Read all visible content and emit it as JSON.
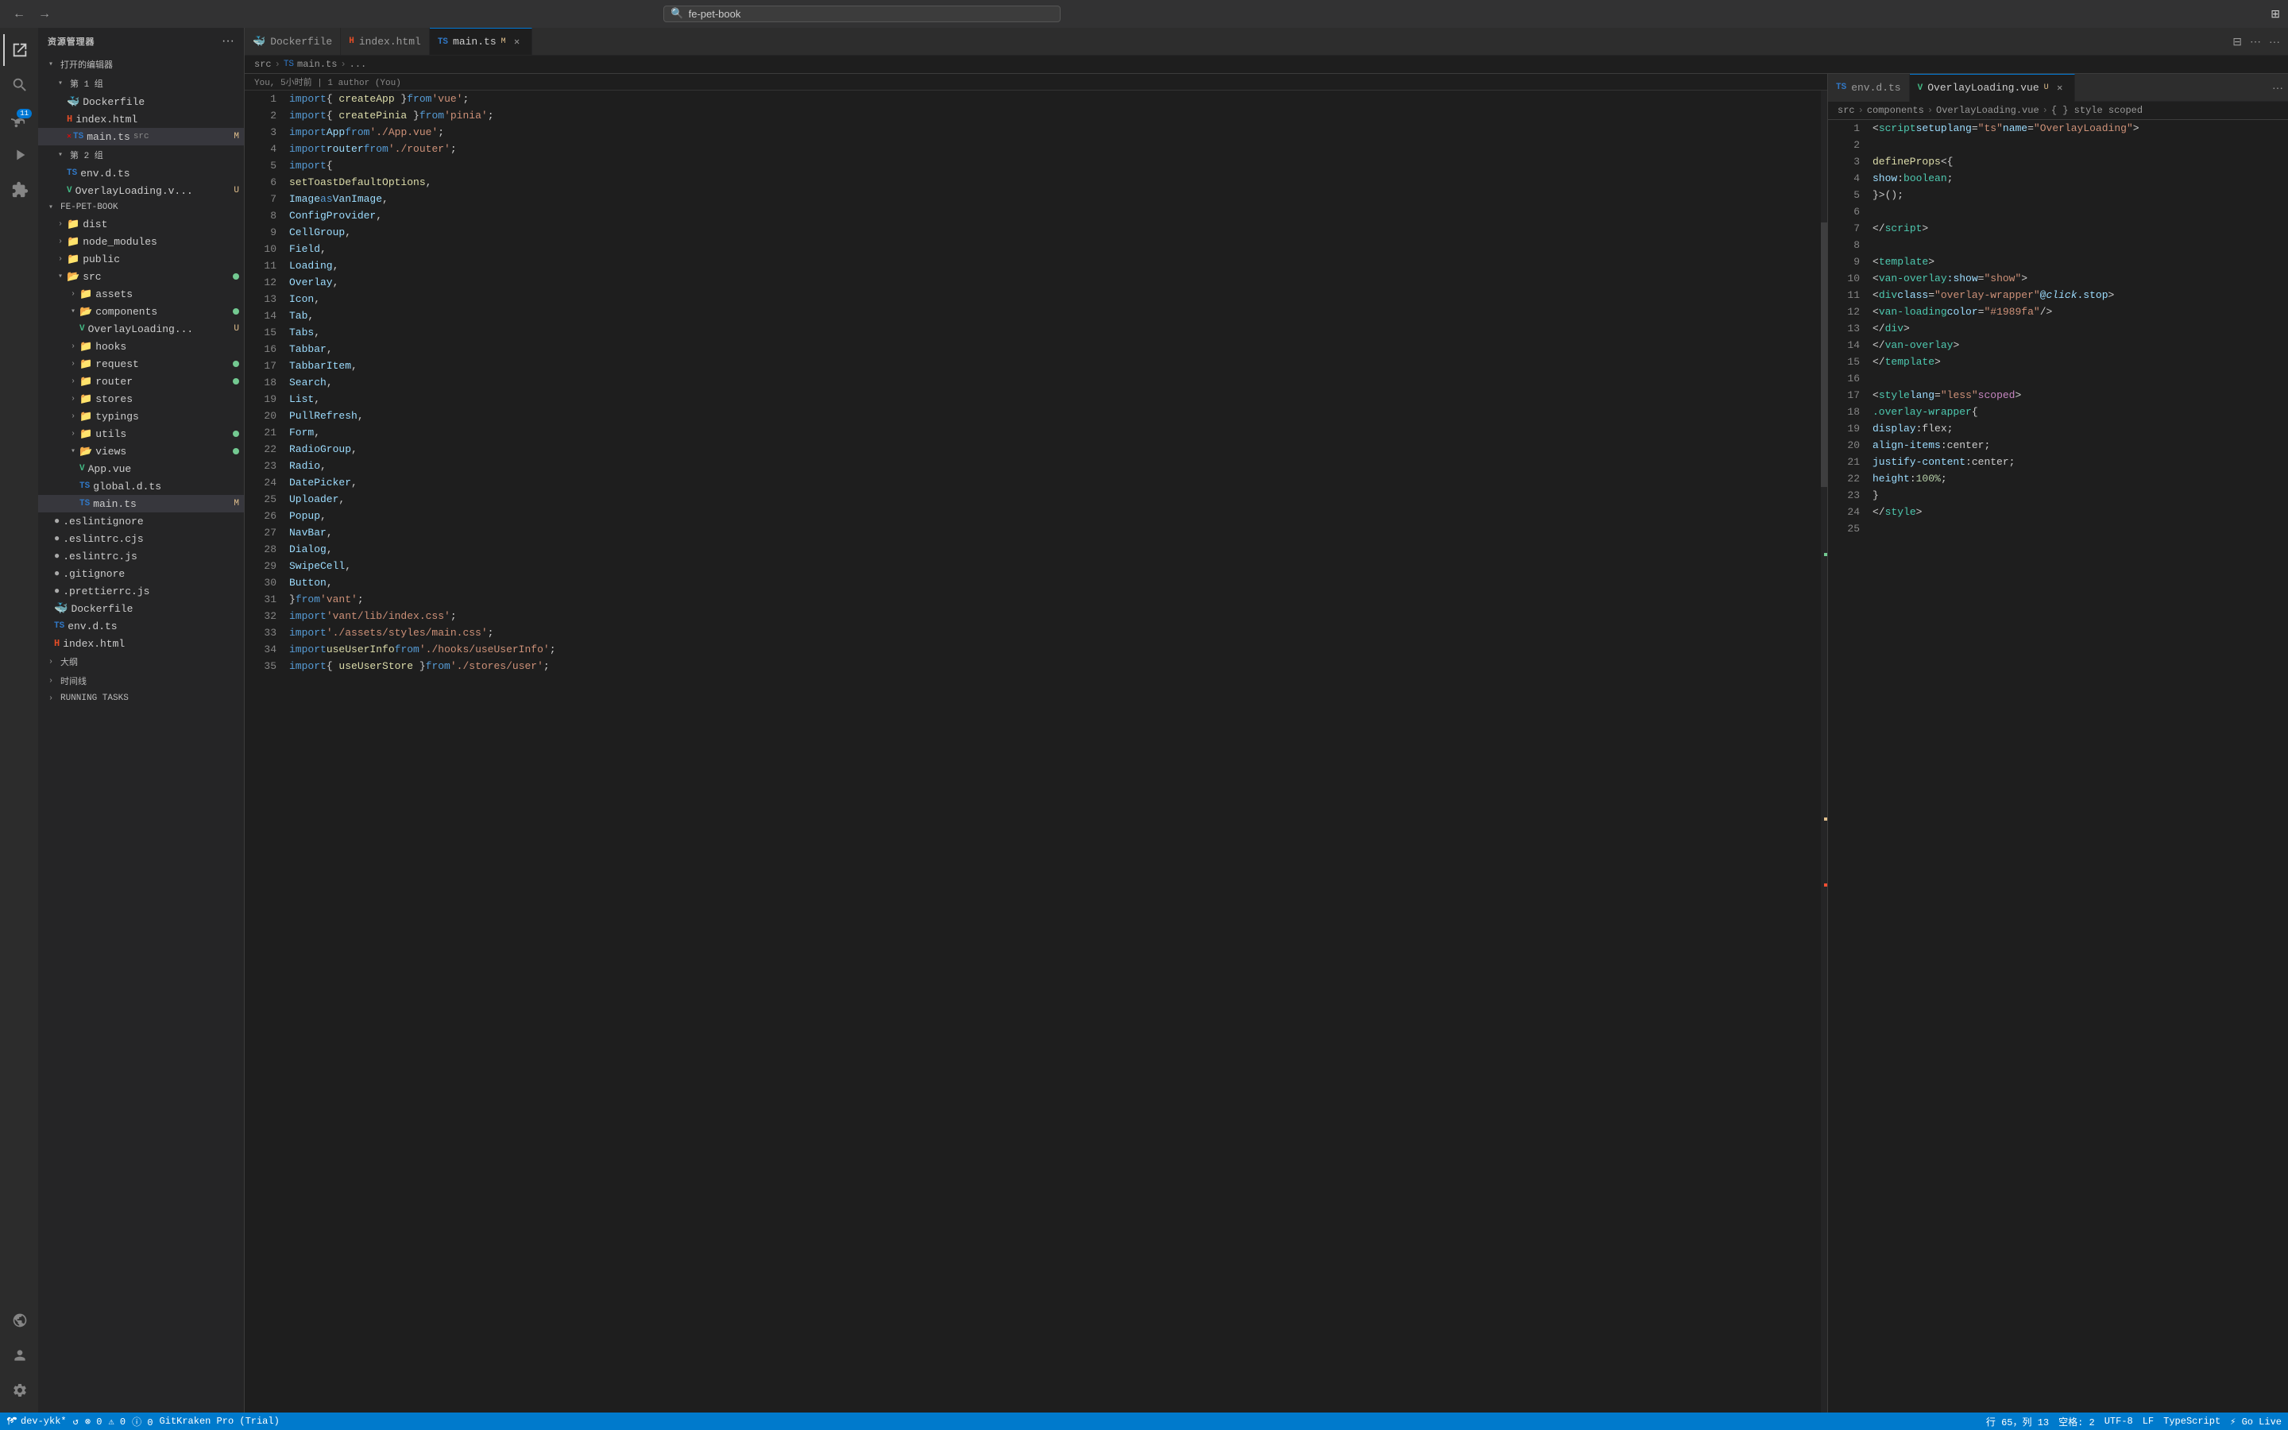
{
  "titlebar": {
    "search_placeholder": "fe-pet-book",
    "nav_back": "←",
    "nav_forward": "→"
  },
  "activity_bar": {
    "items": [
      {
        "name": "explorer-icon",
        "icon": "⎇",
        "label": "Explorer"
      },
      {
        "name": "search-icon",
        "icon": "🔍",
        "label": "Search"
      },
      {
        "name": "source-control-icon",
        "icon": "⑂",
        "label": "Source Control",
        "badge": "11"
      },
      {
        "name": "run-icon",
        "icon": "▷",
        "label": "Run"
      },
      {
        "name": "extensions-icon",
        "icon": "⊞",
        "label": "Extensions"
      }
    ],
    "bottom": [
      {
        "name": "remote-icon",
        "icon": "⧉",
        "label": "Remote"
      },
      {
        "name": "account-icon",
        "icon": "👤",
        "label": "Account"
      },
      {
        "name": "settings-icon",
        "icon": "⚙",
        "label": "Settings"
      }
    ]
  },
  "sidebar": {
    "title": "资源管理器",
    "sections": {
      "open_editors": {
        "label": "打开的编辑器",
        "group1_label": "第 1 组",
        "group1_files": [
          {
            "name": "Dockerfile",
            "icon": "docker",
            "modified": false
          },
          {
            "name": "index.html",
            "icon": "html",
            "modified": false
          },
          {
            "name": "main.ts",
            "icon": "ts",
            "path": "src",
            "modified": true,
            "active": true
          }
        ],
        "group2_label": "第 2 组",
        "group2_files": [
          {
            "name": "env.d.ts",
            "icon": "ts",
            "modified": false
          },
          {
            "name": "OverlayLoading.v...",
            "icon": "vue",
            "modified": true
          }
        ]
      },
      "project": {
        "label": "FE-PET-BOOK",
        "items": [
          {
            "name": "dist",
            "icon": "folder",
            "type": "folder",
            "indent": 1
          },
          {
            "name": "node_modules",
            "icon": "folder",
            "type": "folder",
            "indent": 1
          },
          {
            "name": "public",
            "icon": "folder",
            "type": "folder",
            "indent": 1
          },
          {
            "name": "src",
            "icon": "folder",
            "type": "folder",
            "indent": 1,
            "modified": true,
            "open": true
          },
          {
            "name": "assets",
            "icon": "folder",
            "type": "folder",
            "indent": 2
          },
          {
            "name": "components",
            "icon": "folder",
            "type": "folder",
            "indent": 2,
            "modified": true,
            "open": true
          },
          {
            "name": "OverlayLoading...",
            "icon": "vue",
            "type": "file",
            "indent": 3,
            "modified": true
          },
          {
            "name": "hooks",
            "icon": "folder",
            "type": "folder",
            "indent": 2
          },
          {
            "name": "request",
            "icon": "folder",
            "type": "folder",
            "indent": 2,
            "modified": true
          },
          {
            "name": "router",
            "icon": "folder",
            "type": "folder",
            "indent": 2,
            "modified": true
          },
          {
            "name": "stores",
            "icon": "folder",
            "type": "folder",
            "indent": 2
          },
          {
            "name": "typings",
            "icon": "folder",
            "type": "folder",
            "indent": 2
          },
          {
            "name": "utils",
            "icon": "folder",
            "type": "folder",
            "indent": 2,
            "modified": true
          },
          {
            "name": "views",
            "icon": "folder",
            "type": "folder",
            "indent": 2,
            "modified": true,
            "open": true
          },
          {
            "name": "App.vue",
            "icon": "vue",
            "type": "file",
            "indent": 3
          },
          {
            "name": "global.d.ts",
            "icon": "ts",
            "type": "file",
            "indent": 3
          },
          {
            "name": "main.ts",
            "icon": "ts",
            "type": "file",
            "indent": 3,
            "modified": true,
            "active": true
          },
          {
            "name": ".eslintignore",
            "icon": "git",
            "type": "file",
            "indent": 1
          },
          {
            "name": ".eslintrc.cjs",
            "icon": "js",
            "type": "file",
            "indent": 1
          },
          {
            "name": ".eslintrc.js",
            "icon": "js",
            "type": "file",
            "indent": 1
          },
          {
            "name": ".gitignore",
            "icon": "git",
            "type": "file",
            "indent": 1
          },
          {
            "name": ".prettierrc.js",
            "icon": "js",
            "type": "file",
            "indent": 1
          },
          {
            "name": "Dockerfile",
            "icon": "docker",
            "type": "file",
            "indent": 1
          },
          {
            "name": "env.d.ts",
            "icon": "ts",
            "type": "file",
            "indent": 1
          },
          {
            "name": "index.html",
            "icon": "html",
            "type": "file",
            "indent": 1
          }
        ]
      },
      "account": {
        "label": "大纲"
      },
      "timeline": {
        "label": "时间线"
      },
      "running_tasks": {
        "label": "RUNNING TASKS"
      }
    }
  },
  "editor_left": {
    "tabs": [
      {
        "name": "Dockerfile",
        "icon": "docker",
        "active": false,
        "closable": false
      },
      {
        "name": "index.html",
        "icon": "html",
        "active": false,
        "closable": false
      },
      {
        "name": "main.ts",
        "icon": "ts",
        "active": true,
        "modified": true,
        "closable": true
      }
    ],
    "breadcrumb": [
      "src",
      ">",
      "ts",
      "main.ts",
      ">",
      "..."
    ],
    "git_blame": "You, 5小时前 | 1 author (You)",
    "lines": [
      {
        "n": 1,
        "code": "<span class='kw'>import</span> <span class='punct'>{ </span><span class='fn'>createApp</span><span class='punct'> }</span> <span class='kw'>from</span> <span class='str'>'vue'</span><span class='punct'>;</span>"
      },
      {
        "n": 2,
        "code": "<span class='kw'>import</span> <span class='punct'>{ </span><span class='fn'>createPinia</span><span class='punct'> }</span> <span class='kw'>from</span> <span class='str'>'pinia'</span><span class='punct'>;</span>"
      },
      {
        "n": 3,
        "code": "<span class='kw'>import</span> <span class='var'>App</span> <span class='kw'>from</span> <span class='str'>'./App.vue'</span><span class='punct'>;</span>"
      },
      {
        "n": 4,
        "code": "<span class='kw'>import</span> <span class='var'>router</span> <span class='kw'>from</span> <span class='str'>'./router'</span><span class='punct'>;</span>"
      },
      {
        "n": 5,
        "code": "<span class='kw'>import</span> <span class='punct'>{</span>"
      },
      {
        "n": 6,
        "code": "  <span class='fn'>setToastDefaultOptions</span><span class='punct'>,</span>"
      },
      {
        "n": 7,
        "code": "  <span class='var'>Image</span> <span class='kw'>as</span> <span class='var'>VanImage</span><span class='punct'>,</span>"
      },
      {
        "n": 8,
        "code": "  <span class='var'>ConfigProvider</span><span class='punct'>,</span>"
      },
      {
        "n": 9,
        "code": "  <span class='var'>CellGroup</span><span class='punct'>,</span>"
      },
      {
        "n": 10,
        "code": "  <span class='var'>Field</span><span class='punct'>,</span>"
      },
      {
        "n": 11,
        "code": "  <span class='var'>Loading</span><span class='punct'>,</span>"
      },
      {
        "n": 12,
        "code": "  <span class='var'>Overlay</span><span class='punct'>,</span>"
      },
      {
        "n": 13,
        "code": "  <span class='var'>Icon</span><span class='punct'>,</span>"
      },
      {
        "n": 14,
        "code": "  <span class='var'>Tab</span><span class='punct'>,</span>"
      },
      {
        "n": 15,
        "code": "  <span class='var'>Tabs</span><span class='punct'>,</span>"
      },
      {
        "n": 16,
        "code": "  <span class='var'>Tabbar</span><span class='punct'>,</span>"
      },
      {
        "n": 17,
        "code": "  <span class='var'>TabbarItem</span><span class='punct'>,</span>"
      },
      {
        "n": 18,
        "code": "  <span class='var'>Search</span><span class='punct'>,</span>"
      },
      {
        "n": 19,
        "code": "  <span class='var'>List</span><span class='punct'>,</span>"
      },
      {
        "n": 20,
        "code": "  <span class='var'>PullRefresh</span><span class='punct'>,</span>"
      },
      {
        "n": 21,
        "code": "  <span class='var'>Form</span><span class='punct'>,</span>"
      },
      {
        "n": 22,
        "code": "  <span class='var'>RadioGroup</span><span class='punct'>,</span>"
      },
      {
        "n": 23,
        "code": "  <span class='var'>Radio</span><span class='punct'>,</span>"
      },
      {
        "n": 24,
        "code": "  <span class='var'>DatePicker</span><span class='punct'>,</span>"
      },
      {
        "n": 25,
        "code": "  <span class='var'>Uploader</span><span class='punct'>,</span>"
      },
      {
        "n": 26,
        "code": "  <span class='var'>Popup</span><span class='punct'>,</span>"
      },
      {
        "n": 27,
        "code": "  <span class='var'>NavBar</span><span class='punct'>,</span>"
      },
      {
        "n": 28,
        "code": "  <span class='var'>Dialog</span><span class='punct'>,</span>"
      },
      {
        "n": 29,
        "code": "  <span class='var'>SwipeCell</span><span class='punct'>,</span>"
      },
      {
        "n": 30,
        "code": "  <span class='var'>Button</span><span class='punct'>,</span>"
      },
      {
        "n": 31,
        "code": "<span class='punct'>}</span> <span class='kw'>from</span> <span class='str'>'vant'</span><span class='punct'>;</span>"
      },
      {
        "n": 32,
        "code": "<span class='kw'>import</span> <span class='str'>'vant/lib/index.css'</span><span class='punct'>;</span>"
      },
      {
        "n": 33,
        "code": "<span class='kw'>import</span> <span class='str'>'./assets/styles/main.css'</span><span class='punct'>;</span>"
      },
      {
        "n": 34,
        "code": "<span class='kw'>import</span> <span class='fn'>useUserInfo</span> <span class='kw'>from</span> <span class='str'>'./hooks/useUserInfo'</span><span class='punct'>;</span>"
      },
      {
        "n": 35,
        "code": "<span class='kw'>import</span> <span class='punct'>{ </span><span class='fn'>useUserStore</span><span class='punct'> }</span> <span class='kw'>from</span> <span class='str'>'./stores/user'</span><span class='punct'>;</span>"
      }
    ]
  },
  "editor_right": {
    "tabs": [
      {
        "name": "env.d.ts",
        "icon": "ts",
        "active": false,
        "closable": false
      },
      {
        "name": "OverlayLoading.vue",
        "icon": "vue",
        "active": true,
        "modified": true,
        "closable": true
      }
    ],
    "breadcrumb": [
      "src",
      ">",
      "components",
      ">",
      "OverlayLoading.vue",
      ">",
      "{ } style scoped"
    ],
    "lines": [
      {
        "n": 1,
        "code": "  <span class='punct'>&lt;</span><span class='tag'>script</span> <span class='attr'>setup</span> <span class='attr'>lang</span><span class='punct'>=</span><span class='str'>\"ts\"</span> <span class='attr'>name</span><span class='punct'>=</span><span class='str'>\"OverlayLoading\"</span><span class='punct'>&gt;</span>"
      },
      {
        "n": 2,
        "code": ""
      },
      {
        "n": 3,
        "code": "  <span class='fn'>defineProps</span><span class='punct'>&lt;{</span>"
      },
      {
        "n": 4,
        "code": "    <span class='prop'>show</span><span class='punct'>:</span> <span class='type'>boolean</span><span class='punct'>;</span>"
      },
      {
        "n": 5,
        "code": "  <span class='punct'>}&gt;();</span>"
      },
      {
        "n": 6,
        "code": ""
      },
      {
        "n": 7,
        "code": "  <span class='punct'>&lt;/</span><span class='tag'>script</span><span class='punct'>&gt;</span>"
      },
      {
        "n": 8,
        "code": ""
      },
      {
        "n": 9,
        "code": "  <span class='punct'>&lt;</span><span class='tag'>template</span><span class='punct'>&gt;</span>"
      },
      {
        "n": 10,
        "code": "    <span class='punct'>&lt;</span><span class='tag'>van-overlay</span> <span class='attr'>:show</span><span class='punct'>=</span><span class='str'>\"show\"</span><span class='punct'>&gt;</span>"
      },
      {
        "n": 11,
        "code": "      <span class='punct'>&lt;</span><span class='tag'>div</span> <span class='attr'>class</span><span class='punct'>=</span><span class='str'>\"overlay-wrapper\"</span> <span class='attr'>@<em>click</em>.stop</span><span class='punct'>&gt;</span>"
      },
      {
        "n": 12,
        "code": "        <span class='punct'>&lt;</span><span class='tag'>van-loading</span> <span class='attr'>color</span><span class='punct'>=</span><span class='str'>\"#1989fa\"</span> <span class='punct'>/&gt;</span>"
      },
      {
        "n": 13,
        "code": "      <span class='punct'>&lt;/</span><span class='tag'>div</span><span class='punct'>&gt;</span>"
      },
      {
        "n": 14,
        "code": "    <span class='punct'>&lt;/</span><span class='tag'>van-overlay</span><span class='punct'>&gt;</span>"
      },
      {
        "n": 15,
        "code": "  <span class='punct'>&lt;/</span><span class='tag'>template</span><span class='punct'>&gt;</span>"
      },
      {
        "n": 16,
        "code": ""
      },
      {
        "n": 17,
        "code": "  <span class='punct'>&lt;</span><span class='tag'>style</span> <span class='attr'>lang</span><span class='punct'>=</span><span class='str'>\"less\"</span> <span class='kw2'>scoped</span><span class='punct'>&gt;</span>"
      },
      {
        "n": 18,
        "code": "  <span class='cls'>.overlay-wrapper</span> <span class='punct'>{</span>"
      },
      {
        "n": 19,
        "code": "    <span class='prop'>display</span><span class='punct'>:</span> <span class='plain'>flex</span><span class='punct'>;</span>"
      },
      {
        "n": 20,
        "code": "    <span class='prop'>align-items</span><span class='punct'>:</span> <span class='plain'>center</span><span class='punct'>;</span>"
      },
      {
        "n": 21,
        "code": "    <span class='prop'>justify-content</span><span class='punct'>:</span> <span class='plain'>center</span><span class='punct'>;</span>"
      },
      {
        "n": 22,
        "code": "    <span class='prop'>height</span><span class='punct'>:</span> <span class='num'>100%</span><span class='punct'>;</span>"
      },
      {
        "n": 23,
        "code": "  <span class='punct'>}</span>"
      },
      {
        "n": 24,
        "code": "  <span class='punct'>&lt;/</span><span class='tag'>style</span><span class='punct'>&gt;</span>"
      },
      {
        "n": 25,
        "code": ""
      }
    ]
  },
  "status_bar": {
    "branch": "dev-ykk*",
    "sync": "↺",
    "errors": "⊗ 0",
    "warnings": "⚠ 0",
    "info": "ℹ 0",
    "git_kraken": "GitKraken Pro (Trial)",
    "cursor": "行 65，列 13",
    "spaces": "空格: 2",
    "encoding": "UTF-8",
    "line_ending": "LF",
    "language": "TypeScript",
    "go_live": "⚡ Go Live"
  }
}
